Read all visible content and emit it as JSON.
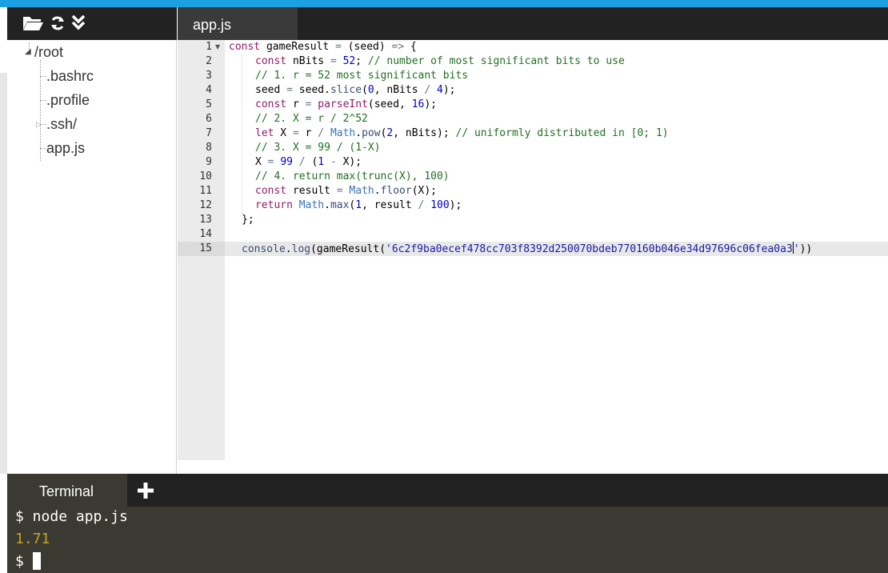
{
  "filetree": {
    "toolbar": {
      "open_icon": "folder-open-icon",
      "refresh_icon": "refresh-icon",
      "collapse_icon": "double-chevron-down-icon"
    },
    "root": "/root",
    "children": [
      ".bashrc",
      ".profile",
      ".ssh/",
      "app.js"
    ]
  },
  "editor": {
    "tab_label": "app.js",
    "line_numbers": [
      "1",
      "2",
      "3",
      "4",
      "5",
      "6",
      "7",
      "8",
      "9",
      "10",
      "11",
      "12",
      "13",
      "14",
      "15"
    ],
    "fold_marker": "▼",
    "active_line": "15"
  },
  "code_tokens": {
    "l1": [
      "const",
      " gameResult ",
      "=",
      " (seed) ",
      "=>",
      " {"
    ],
    "l2": [
      "const",
      " nBits ",
      "=",
      " ",
      "52",
      "; ",
      "// number of most significant bits to use"
    ],
    "l3": [
      "// 1. r = 52 most significant bits"
    ],
    "l4": [
      "seed ",
      "=",
      " seed.",
      "slice",
      "(",
      "0",
      ", nBits ",
      "/",
      " ",
      "4",
      ");"
    ],
    "l5": [
      "const",
      " r ",
      "=",
      " ",
      "parseInt",
      "(seed, ",
      "16",
      ");"
    ],
    "l6": [
      "// 2. X = r / 2^52"
    ],
    "l7": [
      "let",
      " X ",
      "=",
      " r ",
      "/",
      " ",
      "Math",
      ".",
      "pow",
      "(",
      "2",
      ", nBits); ",
      "// uniformly distributed in [0; 1)"
    ],
    "l8": [
      "// 3. X = 99 / (1-X)"
    ],
    "l9": [
      "X ",
      "=",
      " ",
      "99",
      " ",
      "/",
      " (",
      "1",
      " ",
      "-",
      " X);"
    ],
    "l10": [
      "// 4. return max(trunc(X), 100)"
    ],
    "l11": [
      "const",
      " result ",
      "=",
      " ",
      "Math",
      ".",
      "floor",
      "(X);"
    ],
    "l12": [
      "return",
      " ",
      "Math",
      ".",
      "max",
      "(",
      "1",
      ", result ",
      "/",
      " ",
      "100",
      ");"
    ],
    "l13": [
      "};"
    ],
    "l15": [
      "console",
      ".",
      "log",
      "(gameResult(",
      "'6c2f9ba0ecef478cc703f8392d250070bdeb770160b046e34d97696c06fea0a3",
      "'",
      "))"
    ]
  },
  "terminal": {
    "tab_label": "Terminal",
    "add_icon": "plus-icon",
    "lines": [
      {
        "prompt": "$",
        "text": " node app.js"
      },
      {
        "output": "1.71"
      },
      {
        "prompt": "$",
        "text": " "
      }
    ]
  },
  "colors": {
    "accent": "#1ba1e2",
    "dark": "#222222",
    "terminal_bg": "#3b3a32",
    "output": "#c8a415"
  }
}
